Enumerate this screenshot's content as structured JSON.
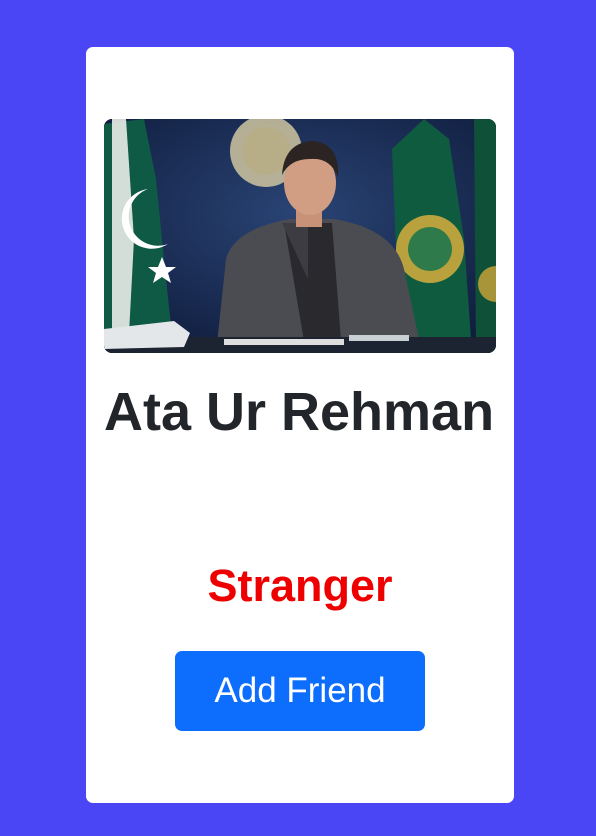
{
  "profile": {
    "photo_icon": "profile-photo",
    "name": "Ata Ur Rehman",
    "status": "Stranger",
    "status_color": "#ee0000",
    "add_friend_label": "Add Friend",
    "button_color": "#0d6efd"
  },
  "colors": {
    "page_background": "#4a45f5",
    "card_background": "#ffffff",
    "name_color": "#222529"
  }
}
